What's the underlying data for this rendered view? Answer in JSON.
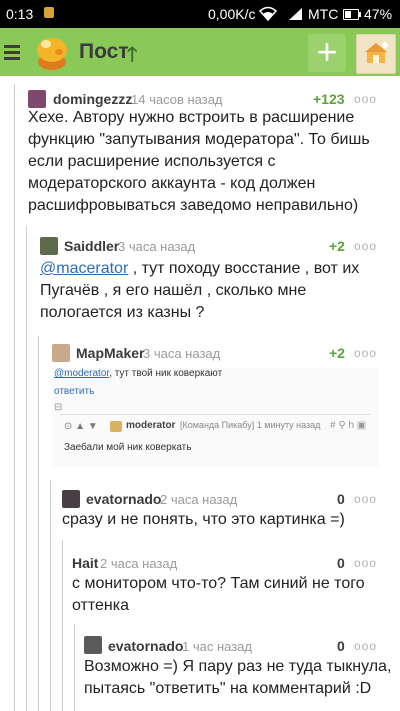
{
  "status_bar": {
    "time": "0:13",
    "speed": "0,00K/c",
    "carrier": "МТС",
    "battery": "47%"
  },
  "app_bar": {
    "title": "Пост",
    "arrow": "🡑",
    "plus": "+"
  },
  "comments": [
    {
      "author": "domingezzz",
      "time": "14 часов назад",
      "rating": "+123",
      "dots": "ooo",
      "lines": [
        "Хехе. Автору нужно встроить в расширение",
        "функцию \"запутывания модератора\". То бишь",
        "если расширение используется с",
        "модераторского аккаунта - код должен",
        "расшифровываться заведомо неправильно)"
      ]
    },
    {
      "author": "Saiddler",
      "time": "3 часа назад",
      "rating": "+2",
      "dots": "ooo",
      "mention": "@macerator",
      "line1_rest": " , тут походу восстание , вот их",
      "lines": [
        "Пугачёв , я его нашёл , сколько мне",
        "пологается из казны ?"
      ]
    },
    {
      "author": "MapMaker",
      "time": "3 часа назад",
      "rating": "+2",
      "dots": "ooo",
      "screenshot": {
        "mention": "@moderator",
        "rest": ", тут твой ник коверкают",
        "reply": "ответить",
        "toggle": "⊟",
        "arrows": "⊙ ▲ ▼",
        "mod_name": "moderator",
        "mod_meta": "[Команда Пикабу] 1 минуту назад",
        "icons": "# ⚲ h ▣",
        "text": "Заебали мой ник коверкать"
      }
    },
    {
      "author": "evatornado",
      "time": "2 часа назад",
      "rating": "0",
      "dots": "ooo",
      "lines": [
        "сразу и не понять, что это картинка =)"
      ]
    },
    {
      "author": "Hait",
      "time": "2 часа назад",
      "rating": "0",
      "dots": "ooo",
      "lines": [
        "с монитором что-то? Там синий не того",
        "оттенка"
      ]
    },
    {
      "author": "evatornado",
      "time": "1 час назад",
      "rating": "0",
      "dots": "ooo",
      "lines": [
        "Возможно =) Я пару раз не туда тыкнула,",
        "пытаясь \"ответить\" на комментарий :D"
      ]
    }
  ]
}
